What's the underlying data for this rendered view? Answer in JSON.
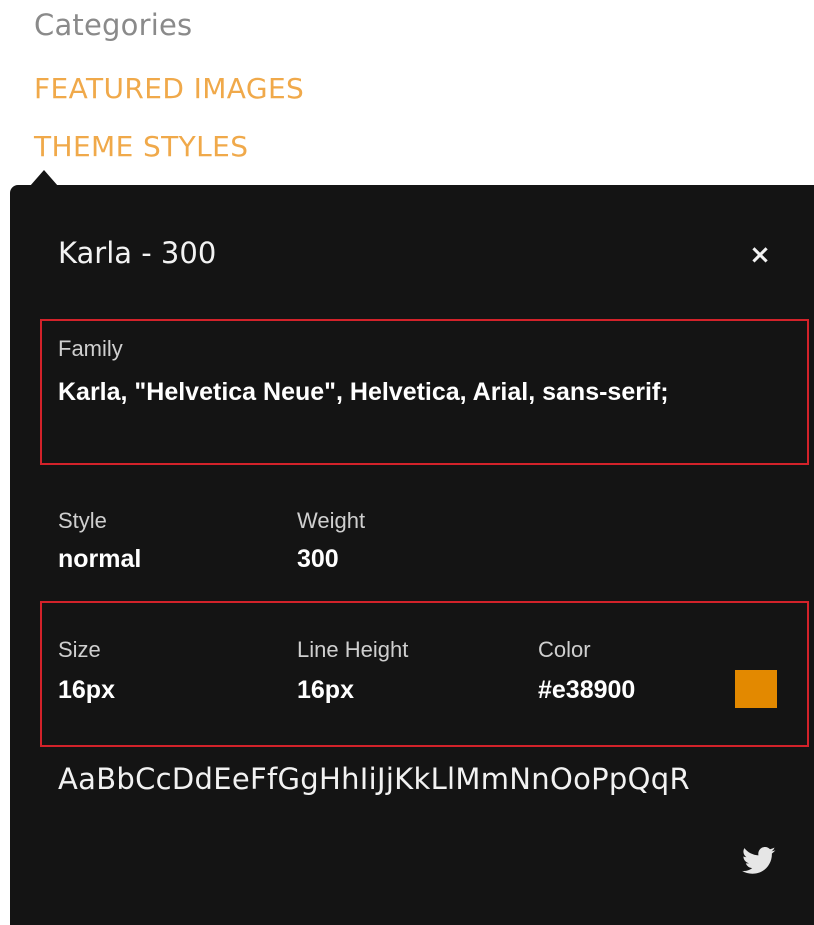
{
  "sidebar": {
    "heading": "Categories",
    "links": [
      {
        "label": "FEATURED IMAGES"
      },
      {
        "label": "THEME STYLES"
      }
    ]
  },
  "popover": {
    "title": "Karla - 300",
    "close_label": "×",
    "family": {
      "label": "Family",
      "value": "Karla, \"Helvetica Neue\", Helvetica, Arial, sans-serif;"
    },
    "style": {
      "label": "Style",
      "value": "normal"
    },
    "weight": {
      "label": "Weight",
      "value": "300"
    },
    "size": {
      "label": "Size",
      "value": "16px"
    },
    "line_height": {
      "label": "Line Height",
      "value": "16px"
    },
    "color": {
      "label": "Color",
      "value": "#e38900"
    },
    "sample_text": "AaBbCcDdEeFfGgHhIiJjKkLlMmNnOoPpQqR",
    "share_icon": "twitter-icon"
  },
  "colors": {
    "panel_bg": "#141414",
    "accent_link": "#f0a94a",
    "highlight": "#d3222a",
    "swatch": "#e38900"
  }
}
